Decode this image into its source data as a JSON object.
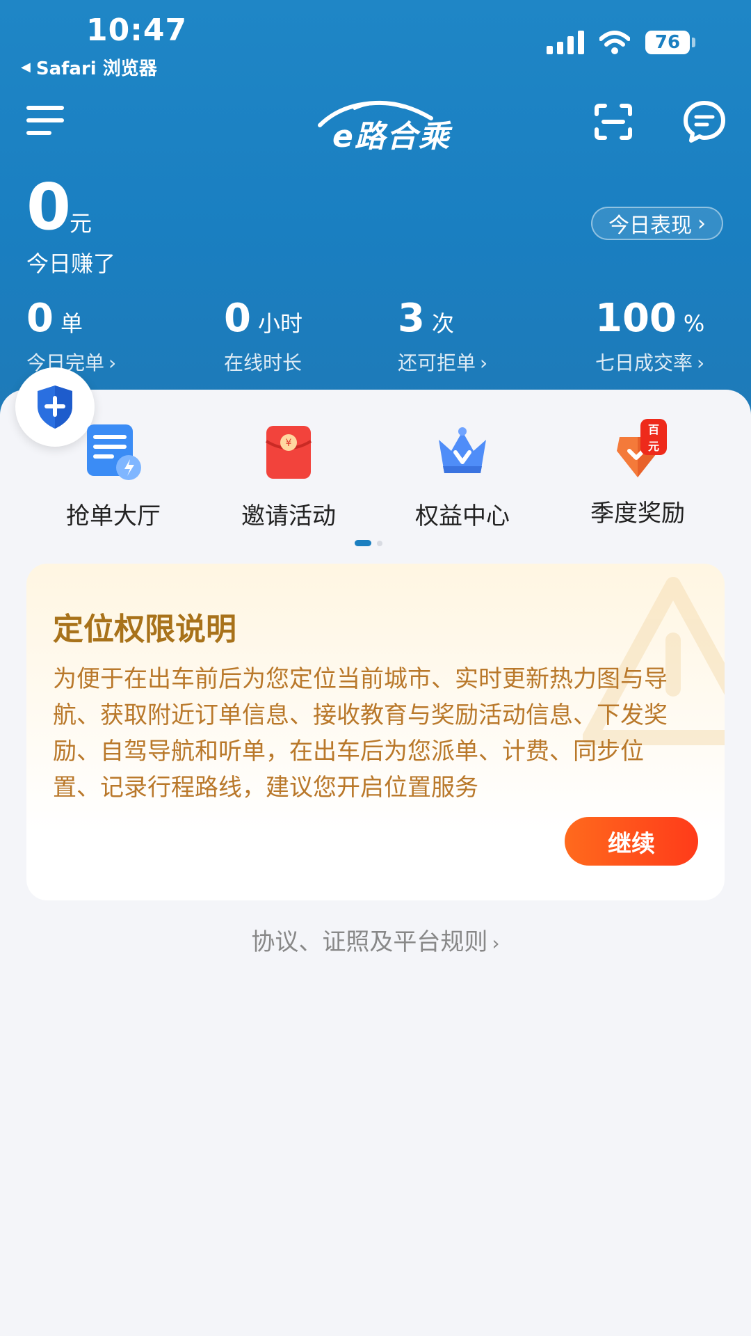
{
  "status_bar": {
    "time": "10:47",
    "back_app": "Safari 浏览器",
    "battery": "76"
  },
  "nav": {
    "logo_text": "e路合乘",
    "icons": [
      "menu-icon",
      "scan-icon",
      "chat-icon"
    ]
  },
  "earnings": {
    "value": "0",
    "unit": "元",
    "label": "今日赚了",
    "performance_button": "今日表现"
  },
  "stats": [
    {
      "value": "0",
      "unit": "单",
      "label": "今日完单"
    },
    {
      "value": "0",
      "unit": "小时",
      "label": "在线时长"
    },
    {
      "value": "3",
      "unit": "次",
      "label": "还可拒单"
    },
    {
      "value": "100",
      "unit": "%",
      "label": "七日成交率"
    }
  ],
  "features": [
    {
      "label": "抢单大厅",
      "icon": "order-hall-icon"
    },
    {
      "label": "邀请活动",
      "icon": "red-envelope-icon"
    },
    {
      "label": "权益中心",
      "icon": "crown-icon"
    },
    {
      "label": "季度奖励",
      "icon": "reward-badge-icon",
      "badge": "百元"
    }
  ],
  "permission": {
    "title": "定位权限说明",
    "body": "为便于在出车前后为您定位当前城市、实时更新热力图与导航、获取附近订单信息、接收教育与奖励活动信息、下发奖励、自驾导航和听单，在出车后为您派单、计费、同步位置、记录行程路线，建议您开启位置服务",
    "button": "继续"
  },
  "footer": {
    "rules_link": "协议、证照及平台规则"
  },
  "colors": {
    "header_blue": "#1a7fc1",
    "accent_orange": "#ff4a1a",
    "permission_text": "#b9782a"
  }
}
